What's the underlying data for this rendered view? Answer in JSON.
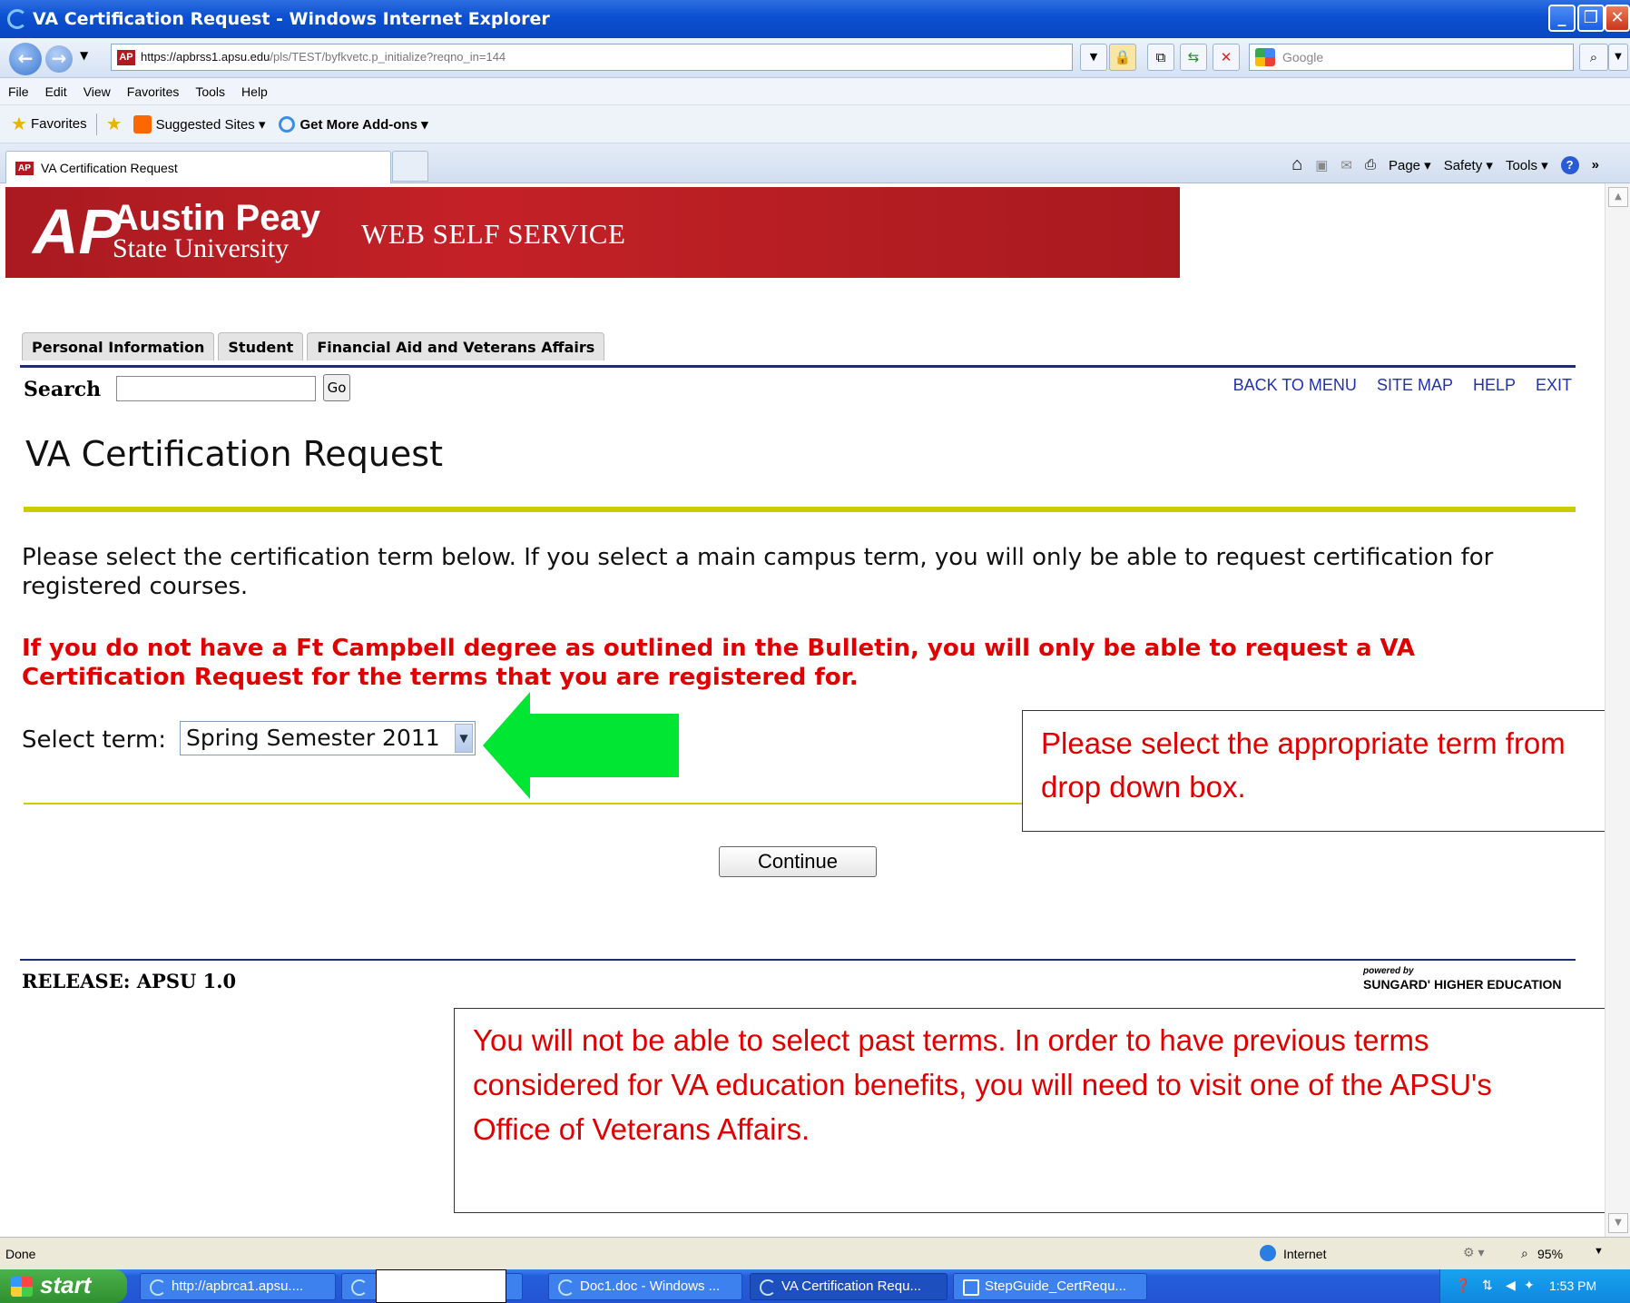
{
  "window": {
    "title": "VA Certification Request - Windows Internet Explorer"
  },
  "address": {
    "url_domain": "https://apbrss1.apsu.edu",
    "url_path": "/pls/TEST/byfkvetc.p_initialize?reqno_in=144",
    "search_placeholder": "Google"
  },
  "menu": [
    "File",
    "Edit",
    "View",
    "Favorites",
    "Tools",
    "Help"
  ],
  "favorites": {
    "label": "Favorites",
    "suggested": "Suggested Sites ▾",
    "addons": "Get More Add-ons ▾"
  },
  "tab": {
    "title": "VA Certification Request"
  },
  "commandbar": {
    "page": "Page ▾",
    "safety": "Safety ▾",
    "tools": "Tools ▾"
  },
  "site": {
    "logo_mark": "AP",
    "univ_line1": "Austin Peay",
    "univ_line2": "State University",
    "service": "WEB SELF SERVICE",
    "nav_tabs": [
      "Personal Information",
      "Student",
      "Financial Aid and Veterans Affairs"
    ],
    "search_label": "Search",
    "go_label": "Go",
    "links": [
      "BACK TO MENU",
      "SITE MAP",
      "HELP",
      "EXIT"
    ],
    "page_title": "VA Certification Request",
    "intro": "Please select the certification term below. If you select a main campus term, you will only be able to request certification for registered courses.",
    "warning": "If you do not have a Ft Campbell degree as outlined in the Bulletin, you will only be able to request a VA Certification Request for the terms that you are registered for.",
    "term_label": "Select term:",
    "term_value": "Spring Semester 2011",
    "continue_label": "Continue",
    "release": "RELEASE: APSU 1.0",
    "powered_by": "powered by",
    "sungard": "SUNGARD' HIGHER EDUCATION"
  },
  "callouts": {
    "term_line1": "Please select the appropriate term from",
    "term_line2": "drop down box.",
    "past_line1": "You will not be able to select past terms.  In order to have previous terms",
    "past_line2": "considered for VA education benefits, you will need to visit one of the APSU's",
    "past_line3": "Office of Veterans Affairs."
  },
  "status": {
    "left": "Done",
    "zone": "Internet",
    "zoom": "95%"
  },
  "taskbar": {
    "start": "start",
    "tasks": [
      "http://apbrca1.apsu....",
      "",
      "Doc1.doc - Windows ...",
      "VA Certification Requ...",
      "StepGuide_CertRequ..."
    ],
    "clock": "1:53 PM"
  },
  "colors": {
    "banner": "#c32127",
    "callout_text": "#e00000",
    "arrow": "#00e632",
    "rule": "#cbcb00"
  }
}
